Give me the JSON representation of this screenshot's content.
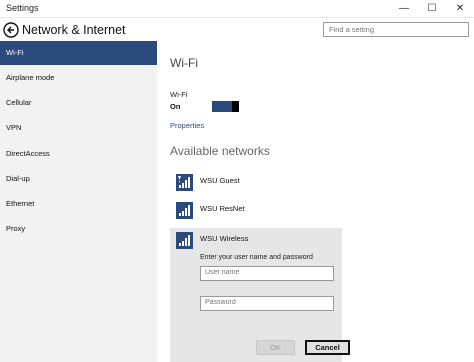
{
  "window": {
    "title": "Settings",
    "minimize_glyph": "—",
    "maximize_glyph": "☐",
    "close_glyph": "✕"
  },
  "header": {
    "title": "Network & Internet",
    "search_placeholder": "Find a setting"
  },
  "sidebar": {
    "items": [
      {
        "label": "Wi-Fi",
        "active": true
      },
      {
        "label": "Airplane mode",
        "active": false
      },
      {
        "label": "Cellular",
        "active": false
      },
      {
        "label": "VPN",
        "active": false
      },
      {
        "label": "DirectAccess",
        "active": false
      },
      {
        "label": "Dial-up",
        "active": false
      },
      {
        "label": "Ethernet",
        "active": false
      },
      {
        "label": "Proxy",
        "active": false
      }
    ]
  },
  "main": {
    "heading": "Wi-Fi",
    "wifi_toggle_label": "Wi-Fi",
    "wifi_toggle_state": "On",
    "properties_link": "Properties",
    "available_heading": "Available networks",
    "networks": [
      {
        "name": "WSU Guest",
        "icon": "wifi-open-icon"
      },
      {
        "name": "WSU ResNet",
        "icon": "wifi-signal-icon"
      },
      {
        "name": "WSU Wireless",
        "icon": "wifi-signal-icon"
      }
    ],
    "login": {
      "prompt": "Enter your user name and password",
      "username_placeholder": "User name",
      "password_placeholder": "Password",
      "ok_label": "OK",
      "cancel_label": "Cancel"
    }
  },
  "colors": {
    "accent": "#2b4a7c",
    "sidebar_bg": "#f2f2f2",
    "expanded_bg": "#e6e6e6"
  }
}
